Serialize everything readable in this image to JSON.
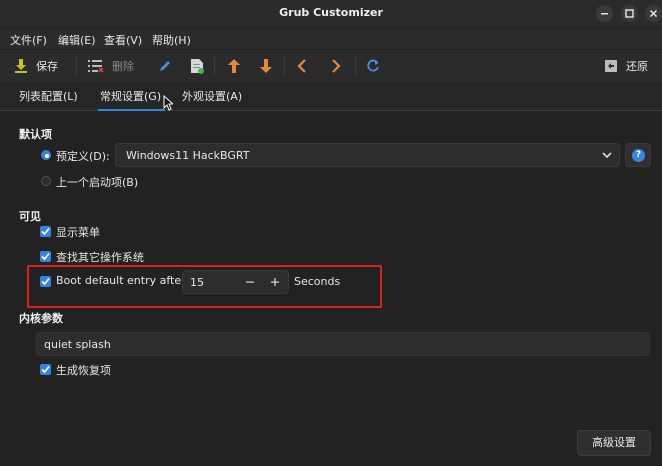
{
  "window": {
    "title": "Grub Customizer",
    "controls": [
      "minimize",
      "maximize",
      "close"
    ]
  },
  "menubar": {
    "items": [
      {
        "label": "文件(F)"
      },
      {
        "label": "编辑(E)"
      },
      {
        "label": "查看(V)"
      },
      {
        "label": "帮助(H)"
      }
    ]
  },
  "toolbar": {
    "save_label": "保存",
    "remove_label": "删除",
    "revert_label": "还原",
    "icons": [
      "save-icon",
      "remove-list-icon",
      "edit-icon",
      "new-entry-icon",
      "move-up-icon",
      "move-down-icon",
      "move-left-icon",
      "move-right-icon",
      "refresh-icon",
      "revert-icon"
    ]
  },
  "tabs": [
    {
      "label": "列表配置(L)",
      "active": false
    },
    {
      "label": "常规设置(G)",
      "active": true
    },
    {
      "label": "外观设置(A)",
      "active": false
    }
  ],
  "default_section": {
    "title": "默认项",
    "predefined_label": "预定义(D):",
    "predefined_selected": true,
    "predefined_value": "Windows11 HackBGRT",
    "previous_label": "上一个启动项(B)",
    "previous_selected": false
  },
  "visibility_section": {
    "title": "可见",
    "show_menu_label": "显示菜单",
    "show_menu_checked": true,
    "look_other_os_label": "查找其它操作系统",
    "look_other_os_checked": true,
    "boot_default_label": "Boot default entry after",
    "boot_default_checked": true,
    "timeout_value": "15",
    "timeout_unit": "Seconds"
  },
  "kernel_section": {
    "title": "内核参数",
    "params_value": "quiet splash",
    "recovery_label": "生成恢复项",
    "recovery_checked": true
  },
  "footer": {
    "advanced_label": "高级设置"
  },
  "colors": {
    "accent": "#3584e4",
    "highlight_box": "#e02020",
    "background": "#222222",
    "up_down_arrows": "#e08a3c"
  }
}
